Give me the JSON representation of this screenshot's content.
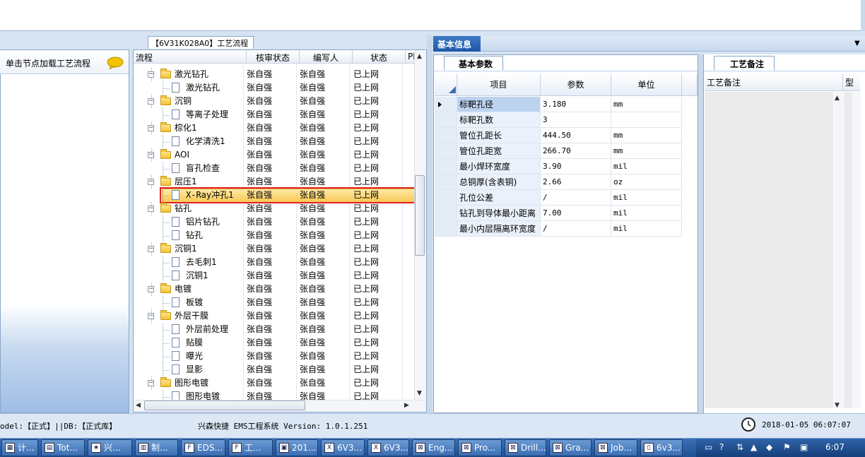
{
  "process_panel": {
    "tab_title": "【6V31K028A0】工艺流程",
    "left_hint": "单击节点加载工艺流程",
    "columns": [
      "流程",
      "核审状态",
      "编写人",
      "状态",
      "Pl"
    ],
    "rows": [
      {
        "name": "激光钻孔",
        "kind": "folder",
        "level": 0,
        "reviewer": "张自强",
        "author": "张自强",
        "status": "已上网"
      },
      {
        "name": "激光钻孔",
        "kind": "doc",
        "level": 1,
        "reviewer": "张自强",
        "author": "张自强",
        "status": "已上网"
      },
      {
        "name": "沉铜",
        "kind": "folder",
        "level": 0,
        "reviewer": "张自强",
        "author": "张自强",
        "status": "已上网"
      },
      {
        "name": "等离子处理",
        "kind": "doc",
        "level": 1,
        "reviewer": "张自强",
        "author": "张自强",
        "status": "已上网"
      },
      {
        "name": "棕化1",
        "kind": "folder",
        "level": 0,
        "reviewer": "张自强",
        "author": "张自强",
        "status": "已上网"
      },
      {
        "name": "化学清洗1",
        "kind": "doc",
        "level": 1,
        "reviewer": "张自强",
        "author": "张自强",
        "status": "已上网"
      },
      {
        "name": "AOI",
        "kind": "folder",
        "level": 0,
        "reviewer": "张自强",
        "author": "张自强",
        "status": "已上网"
      },
      {
        "name": "盲孔检查",
        "kind": "doc",
        "level": 1,
        "reviewer": "张自强",
        "author": "张自强",
        "status": "已上网"
      },
      {
        "name": "层压1",
        "kind": "folder",
        "level": 0,
        "reviewer": "张自强",
        "author": "张自强",
        "status": "已上网"
      },
      {
        "name": "X-Ray冲孔1",
        "kind": "doc",
        "level": 1,
        "reviewer": "张自强",
        "author": "张自强",
        "status": "已上网",
        "selected": true
      },
      {
        "name": "钻孔",
        "kind": "folder",
        "level": 0,
        "reviewer": "张自强",
        "author": "张自强",
        "status": "已上网"
      },
      {
        "name": "铝片钻孔",
        "kind": "doc",
        "level": 1,
        "reviewer": "张自强",
        "author": "张自强",
        "status": "已上网"
      },
      {
        "name": "钻孔",
        "kind": "doc",
        "level": 1,
        "reviewer": "张自强",
        "author": "张自强",
        "status": "已上网"
      },
      {
        "name": "沉铜1",
        "kind": "folder",
        "level": 0,
        "reviewer": "张自强",
        "author": "张自强",
        "status": "已上网"
      },
      {
        "name": "去毛刺1",
        "kind": "doc",
        "level": 1,
        "reviewer": "张自强",
        "author": "张自强",
        "status": "已上网"
      },
      {
        "name": "沉铜1",
        "kind": "doc",
        "level": 1,
        "reviewer": "张自强",
        "author": "张自强",
        "status": "已上网"
      },
      {
        "name": "电镀",
        "kind": "folder",
        "level": 0,
        "reviewer": "张自强",
        "author": "张自强",
        "status": "已上网"
      },
      {
        "name": "板镀",
        "kind": "doc",
        "level": 1,
        "reviewer": "张自强",
        "author": "张自强",
        "status": "已上网"
      },
      {
        "name": "外层干膜",
        "kind": "folder",
        "level": 0,
        "reviewer": "张自强",
        "author": "张自强",
        "status": "已上网"
      },
      {
        "name": "外层前处理",
        "kind": "doc",
        "level": 1,
        "reviewer": "张自强",
        "author": "张自强",
        "status": "已上网"
      },
      {
        "name": "贴膜",
        "kind": "doc",
        "level": 1,
        "reviewer": "张自强",
        "author": "张自强",
        "status": "已上网"
      },
      {
        "name": "曝光",
        "kind": "doc",
        "level": 1,
        "reviewer": "张自强",
        "author": "张自强",
        "status": "已上网"
      },
      {
        "name": "显影",
        "kind": "doc",
        "level": 1,
        "reviewer": "张自强",
        "author": "张自强",
        "status": "已上网"
      },
      {
        "name": "图形电镀",
        "kind": "folder",
        "level": 0,
        "reviewer": "张自强",
        "author": "张自强",
        "status": "已上网"
      },
      {
        "name": "图形电镀",
        "kind": "doc",
        "level": 1,
        "reviewer": "张自强",
        "author": "张自强",
        "status": "已上网"
      }
    ]
  },
  "basic_info": {
    "tab_title": "基本信息",
    "subtab": "基本参数",
    "columns": [
      "项目",
      "参数",
      "单位"
    ],
    "rows": [
      {
        "item": "标靶孔径",
        "value": "3.180",
        "unit": "mm"
      },
      {
        "item": "标靶孔数",
        "value": "3",
        "unit": ""
      },
      {
        "item": "管位孔距长",
        "value": "444.50",
        "unit": "mm"
      },
      {
        "item": "管位孔距宽",
        "value": "266.70",
        "unit": "mm"
      },
      {
        "item": "最小焊环宽度",
        "value": "3.90",
        "unit": "mil"
      },
      {
        "item": "总铜厚(含表铜)",
        "value": "2.66",
        "unit": "oz"
      },
      {
        "item": "孔位公差",
        "value": "/",
        "unit": "mil"
      },
      {
        "item": "钻孔到导体最小距离",
        "value": "7.00",
        "unit": "mil"
      },
      {
        "item": "最小内层隔离环宽度",
        "value": "/",
        "unit": "mil"
      }
    ]
  },
  "notes": {
    "subtab": "工艺备注",
    "column": "工艺备注",
    "column2": "型"
  },
  "status_bar": {
    "left": "odel:【正式】||DB:【正式库】",
    "middle": "兴森快捷 EMS工程系统 Version: 1.0.1.251",
    "datetime": "2018-01-05 06:07:07"
  },
  "taskbar": {
    "buttons": [
      "计...",
      "Tot...",
      "兴...",
      "制...",
      "EDS...",
      "工...",
      "201...",
      "6V3...",
      "6V3...",
      "Eng...",
      "Pro...",
      "Drill...",
      "Gra...",
      "Job...",
      "6v3..."
    ],
    "clock": "6:07"
  }
}
